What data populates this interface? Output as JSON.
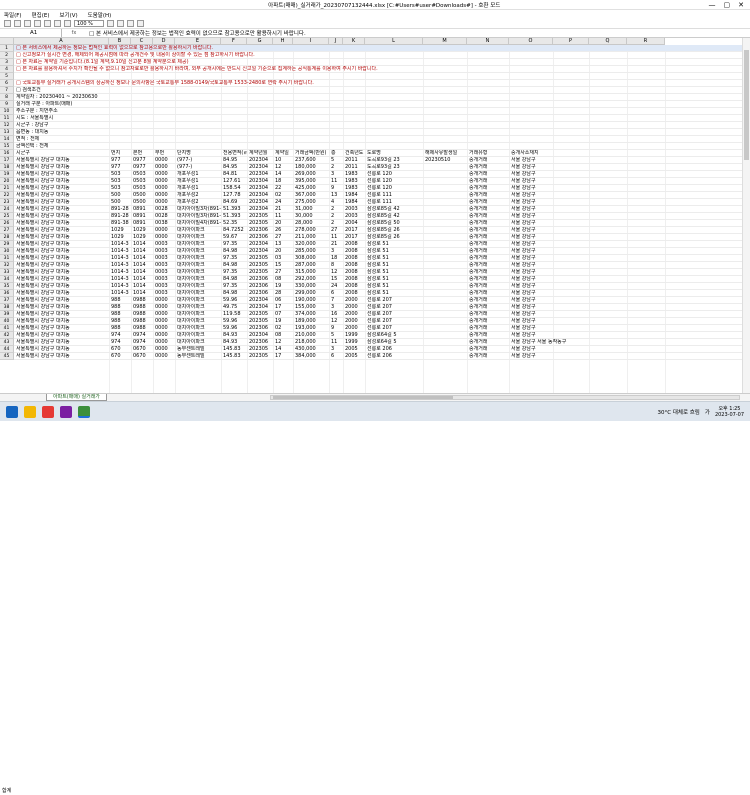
{
  "window": {
    "title": "아파트(매매)_실거래가_20230707132444.xlsx  [C:#Users#user#Downloads#] - 호환 모드",
    "controls": [
      "—",
      "▢",
      "✕"
    ]
  },
  "menu": [
    "파일(F)",
    "편집(E)",
    "보기(V)",
    "도움말(H)"
  ],
  "toolbar": {
    "zoom": "100 %"
  },
  "formula_bar": {
    "cell_ref": "A1",
    "fx": "fx",
    "content": "□ 본 서비스에서 제공하는 정보는 법적인 효력이 없으므로 참고용으로만 활용하시기 바랍니다."
  },
  "columns": [
    "A",
    "B",
    "C",
    "D",
    "E",
    "F",
    "G",
    "H",
    "I",
    "J",
    "K",
    "L",
    "M",
    "N",
    "O",
    "P",
    "Q",
    "R"
  ],
  "notes": [
    "□ 본 서비스에서 제공하는 정보는 법적인 효력이 없으므로 참고용으로만 활용하시기 바랍니다.",
    "□ 신고정보가 실시간 변경, 해제되어 제공시점에 따라 공개건수 및 내용이 상이할 수 있는 점 참고하시기 바랍니다.",
    "□ 본 자료는 계약일 기준입니다.(8.1일 계약,9.10일 신고분 8월 계약분으로 제공)",
    "□ 본 자료를 활용하셔서 수치가 확인될 수 없으니 참고자료로만 활용하시기 바라며, 외부 공개시에는 반드시 신고일 기준으로 집계하는 공식통계를 이용하여 주시기 바랍니다.",
    "",
    "□ 국토교통부 실거래가 공개시스템의 상공하신 정보나 문의사항은 국토교통부 1588-0149/국토교통부 1533-2480로 연락 주시기 바랍니다.",
    "□ 검색조건",
    "계약일자 : 20230401 ~ 20230630",
    "실거래 구분 : 아파트(매매)",
    "주소구분 : 지번주소",
    "시도 : 서울특별시",
    "시군구 : 강남구",
    "읍면동 : 대치동",
    "면적 : 전체",
    "금액선택 : 전체"
  ],
  "headers": [
    "시군구",
    "번지",
    "본번",
    "부번",
    "단지명",
    "전용면적(㎡)",
    "계약년월",
    "계약일",
    "거래금액(만원)",
    "층",
    "건축년도",
    "도로명",
    "해제사유발생일",
    "거래유형",
    "중개사소재지"
  ],
  "rows": [
    [
      "서울특별시 강남구 대치동",
      "977",
      "0977",
      "0000",
      "(977-)",
      "84.95",
      "202304",
      "10",
      "237,600",
      "5",
      "2011",
      "도곡로93길 23",
      "20230510",
      "중개거래",
      "서울 강남구"
    ],
    [
      "서울특별시 강남구 대치동",
      "977",
      "0977",
      "0000",
      "(977-)",
      "84.95",
      "202304",
      "12",
      "180,000",
      "2",
      "2011",
      "도곡로93길 23",
      "",
      "중개거래",
      "서울 강남구"
    ],
    [
      "서울특별시 강남구 대치동",
      "503",
      "0503",
      "0000",
      "개포우성1",
      "84.81",
      "202304",
      "14",
      "269,000",
      "3",
      "1983",
      "선릉로 120",
      "",
      "중개거래",
      "서울 강남구"
    ],
    [
      "서울특별시 강남구 대치동",
      "503",
      "0503",
      "0000",
      "개포우성1",
      "127.61",
      "202304",
      "18",
      "395,000",
      "11",
      "1983",
      "선릉로 120",
      "",
      "중개거래",
      "서울 강남구"
    ],
    [
      "서울특별시 강남구 대치동",
      "503",
      "0503",
      "0000",
      "개포우성1",
      "158.54",
      "202304",
      "22",
      "425,000",
      "9",
      "1983",
      "선릉로 120",
      "",
      "중개거래",
      "서울 강남구"
    ],
    [
      "서울특별시 강남구 대치동",
      "500",
      "0500",
      "0000",
      "개포우성2",
      "127.78",
      "202304",
      "02",
      "367,000",
      "13",
      "1984",
      "선릉로 111",
      "",
      "중개거래",
      "서울 강남구"
    ],
    [
      "서울특별시 강남구 대치동",
      "500",
      "0500",
      "0000",
      "개포우성2",
      "84.69",
      "202304",
      "24",
      "275,000",
      "4",
      "1984",
      "선릉로 111",
      "",
      "중개거래",
      "서울 강남구"
    ],
    [
      "서울특별시 강남구 대치동",
      "891-28",
      "0891",
      "0028",
      "대치아이빌3차(891-28)",
      "51.393",
      "202304",
      "21",
      "31,000",
      "2",
      "2003",
      "삼성로85길 42",
      "",
      "중개거래",
      "서울 강남구"
    ],
    [
      "서울특별시 강남구 대치동",
      "891-28",
      "0891",
      "0028",
      "대치아이빌3차(891-28)",
      "51.393",
      "202305",
      "11",
      "30,000",
      "2",
      "2003",
      "삼성로85길 42",
      "",
      "중개거래",
      "서울 강남구"
    ],
    [
      "서울특별시 강남구 대치동",
      "891-38",
      "0891",
      "0038",
      "대치아이빌4차(891-38)",
      "52.35",
      "202305",
      "20",
      "28,000",
      "2",
      "2004",
      "삼성로85길 50",
      "",
      "중개거래",
      "서울 강남구"
    ],
    [
      "서울특별시 강남구 대치동",
      "1029",
      "1029",
      "0000",
      "대치아이파크",
      "84.7252",
      "202306",
      "26",
      "278,000",
      "27",
      "2017",
      "삼성로85길 26",
      "",
      "중개거래",
      "서울 강남구"
    ],
    [
      "서울특별시 강남구 대치동",
      "1029",
      "1029",
      "0000",
      "대치아이파크",
      "59.67",
      "202306",
      "27",
      "211,000",
      "11",
      "2017",
      "삼성로85길 26",
      "",
      "중개거래",
      "서울 강남구"
    ],
    [
      "서울특별시 강남구 대치동",
      "1014-3",
      "1014",
      "0003",
      "대치아이파크",
      "97.35",
      "202304",
      "13",
      "320,000",
      "21",
      "2008",
      "삼성로 51",
      "",
      "중개거래",
      "서울 강남구"
    ],
    [
      "서울특별시 강남구 대치동",
      "1014-3",
      "1014",
      "0003",
      "대치아이파크",
      "84.98",
      "202304",
      "20",
      "285,000",
      "3",
      "2008",
      "삼성로 51",
      "",
      "중개거래",
      "서울 강남구"
    ],
    [
      "서울특별시 강남구 대치동",
      "1014-3",
      "1014",
      "0003",
      "대치아이파크",
      "97.35",
      "202305",
      "03",
      "308,000",
      "18",
      "2008",
      "삼성로 51",
      "",
      "중개거래",
      "서울 강남구"
    ],
    [
      "서울특별시 강남구 대치동",
      "1014-3",
      "1014",
      "0003",
      "대치아이파크",
      "84.98",
      "202305",
      "15",
      "287,000",
      "8",
      "2008",
      "삼성로 51",
      "",
      "중개거래",
      "서울 강남구"
    ],
    [
      "서울특별시 강남구 대치동",
      "1014-3",
      "1014",
      "0003",
      "대치아이파크",
      "97.35",
      "202305",
      "27",
      "315,000",
      "12",
      "2008",
      "삼성로 51",
      "",
      "중개거래",
      "서울 강남구"
    ],
    [
      "서울특별시 강남구 대치동",
      "1014-3",
      "1014",
      "0003",
      "대치아이파크",
      "84.98",
      "202306",
      "08",
      "292,000",
      "15",
      "2008",
      "삼성로 51",
      "",
      "중개거래",
      "서울 강남구"
    ],
    [
      "서울특별시 강남구 대치동",
      "1014-3",
      "1014",
      "0003",
      "대치아이파크",
      "97.35",
      "202306",
      "19",
      "330,000",
      "24",
      "2008",
      "삼성로 51",
      "",
      "중개거래",
      "서울 강남구"
    ],
    [
      "서울특별시 강남구 대치동",
      "1014-3",
      "1014",
      "0003",
      "대치아이파크",
      "84.98",
      "202306",
      "28",
      "299,000",
      "6",
      "2008",
      "삼성로 51",
      "",
      "중개거래",
      "서울 강남구"
    ],
    [
      "서울특별시 강남구 대치동",
      "988",
      "0988",
      "0000",
      "대치아이파크",
      "59.96",
      "202304",
      "06",
      "190,000",
      "7",
      "2000",
      "선릉로 207",
      "",
      "중개거래",
      "서울 강남구"
    ],
    [
      "서울특별시 강남구 대치동",
      "988",
      "0988",
      "0000",
      "대치아이파크",
      "49.75",
      "202304",
      "17",
      "155,000",
      "3",
      "2000",
      "선릉로 207",
      "",
      "중개거래",
      "서울 강남구"
    ],
    [
      "서울특별시 강남구 대치동",
      "988",
      "0988",
      "0000",
      "대치아이파크",
      "119.58",
      "202305",
      "07",
      "374,000",
      "16",
      "2000",
      "선릉로 207",
      "",
      "중개거래",
      "서울 강남구"
    ],
    [
      "서울특별시 강남구 대치동",
      "988",
      "0988",
      "0000",
      "대치아이파크",
      "59.96",
      "202305",
      "19",
      "189,000",
      "12",
      "2000",
      "선릉로 207",
      "",
      "중개거래",
      "서울 강남구"
    ],
    [
      "서울특별시 강남구 대치동",
      "988",
      "0988",
      "0000",
      "대치아이파크",
      "59.96",
      "202306",
      "02",
      "193,000",
      "9",
      "2000",
      "선릉로 207",
      "",
      "중개거래",
      "서울 강남구"
    ],
    [
      "서울특별시 강남구 대치동",
      "974",
      "0974",
      "0000",
      "대치아이파크",
      "84.93",
      "202304",
      "08",
      "210,000",
      "5",
      "1999",
      "삼성로64길 5",
      "",
      "중개거래",
      "서울 강남구"
    ],
    [
      "서울특별시 강남구 대치동",
      "974",
      "0974",
      "0000",
      "대치아이파크",
      "84.93",
      "202306",
      "12",
      "218,000",
      "11",
      "1999",
      "삼성로64길 5",
      "",
      "중개거래",
      "서울 강남구 서울 동작동구"
    ],
    [
      "서울특별시 강남구 대치동",
      "670",
      "0670",
      "0000",
      "동부센트레빌",
      "145.83",
      "202305",
      "14",
      "430,000",
      "3",
      "2005",
      "선릉로 206",
      "",
      "중개거래",
      "서울 강남구"
    ],
    [
      "서울특별시 강남구 대치동",
      "670",
      "0670",
      "0000",
      "동부센트레빌",
      "145.83",
      "202305",
      "17",
      "384,000",
      "6",
      "2005",
      "선릉로 206",
      "",
      "중개거래",
      "서울 강남구"
    ]
  ],
  "sheet": {
    "tab": "아파트(매매) 실거래가",
    "status": "합계"
  },
  "taskbar": {
    "weather": "30°C 대체로 흐림",
    "time": "오후 1:25",
    "date": "2023-07-07",
    "lang": "가"
  }
}
